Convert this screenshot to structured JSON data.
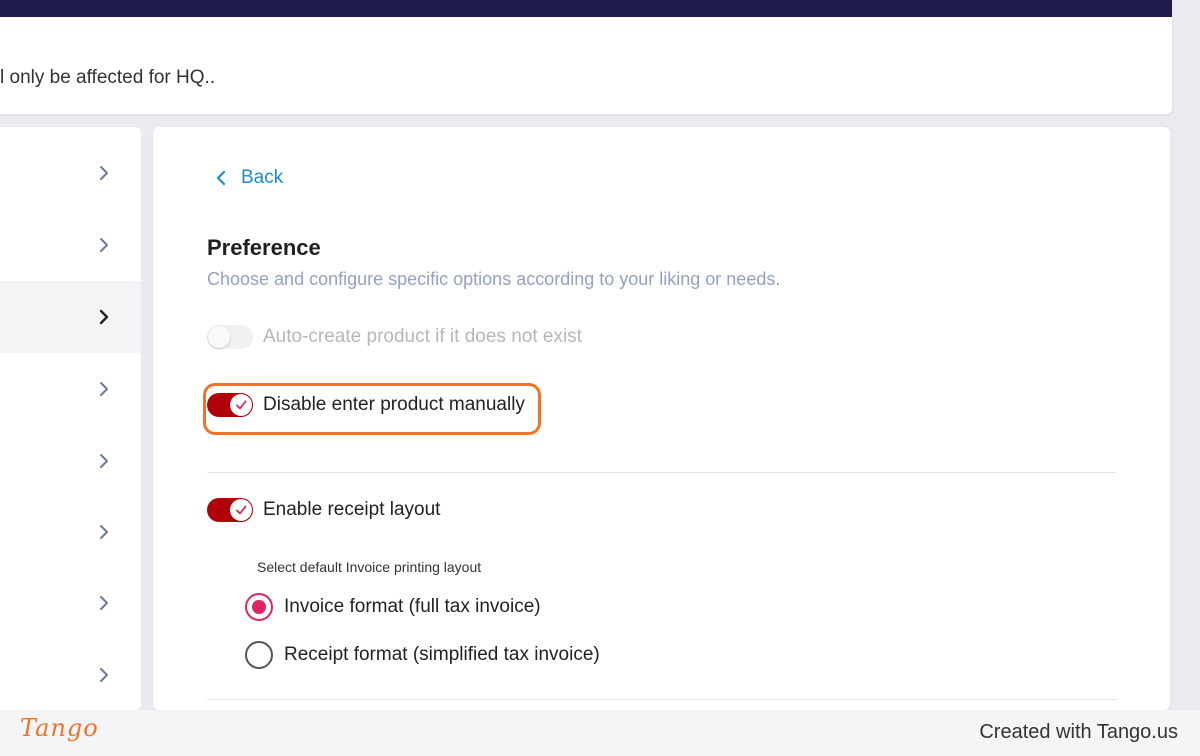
{
  "header": {
    "notice": "l only be affected for HQ.."
  },
  "sidebar": {
    "items": [
      {
        "icon": "chevron-right-icon",
        "active": false
      },
      {
        "icon": "chevron-right-icon",
        "active": false
      },
      {
        "icon": "chevron-right-icon",
        "active": true
      },
      {
        "icon": "chevron-right-icon",
        "active": false
      },
      {
        "icon": "chevron-right-icon",
        "active": false
      },
      {
        "icon": "chevron-right-icon",
        "active": false
      },
      {
        "icon": "chevron-right-icon",
        "active": false
      },
      {
        "icon": "chevron-right-icon",
        "active": false
      }
    ]
  },
  "main": {
    "back_label": "Back",
    "title": "Preference",
    "subtitle": "Choose and configure specific options according to your liking or needs.",
    "toggles": {
      "auto_create": {
        "label": "Auto-create product if it does not exist",
        "on": false,
        "disabled": true
      },
      "disable_manual": {
        "label": "Disable enter product manually",
        "on": true
      },
      "receipt_layout": {
        "label": "Enable receipt layout",
        "on": true
      }
    },
    "layout_select_label": "Select default Invoice printing layout",
    "layout_options": [
      {
        "label": "Invoice format (full tax invoice)",
        "checked": true
      },
      {
        "label": "Receipt format (simplified tax invoice)",
        "checked": false
      }
    ]
  },
  "footer": {
    "logo_text": "Tango",
    "created_text": "Created with Tango.us"
  },
  "colors": {
    "top_bar": "#1e1b4b",
    "accent_red": "#b0000a",
    "radio_pink": "#e0245e",
    "link_blue": "#1a8ec9",
    "highlight_orange": "#f0732a"
  }
}
